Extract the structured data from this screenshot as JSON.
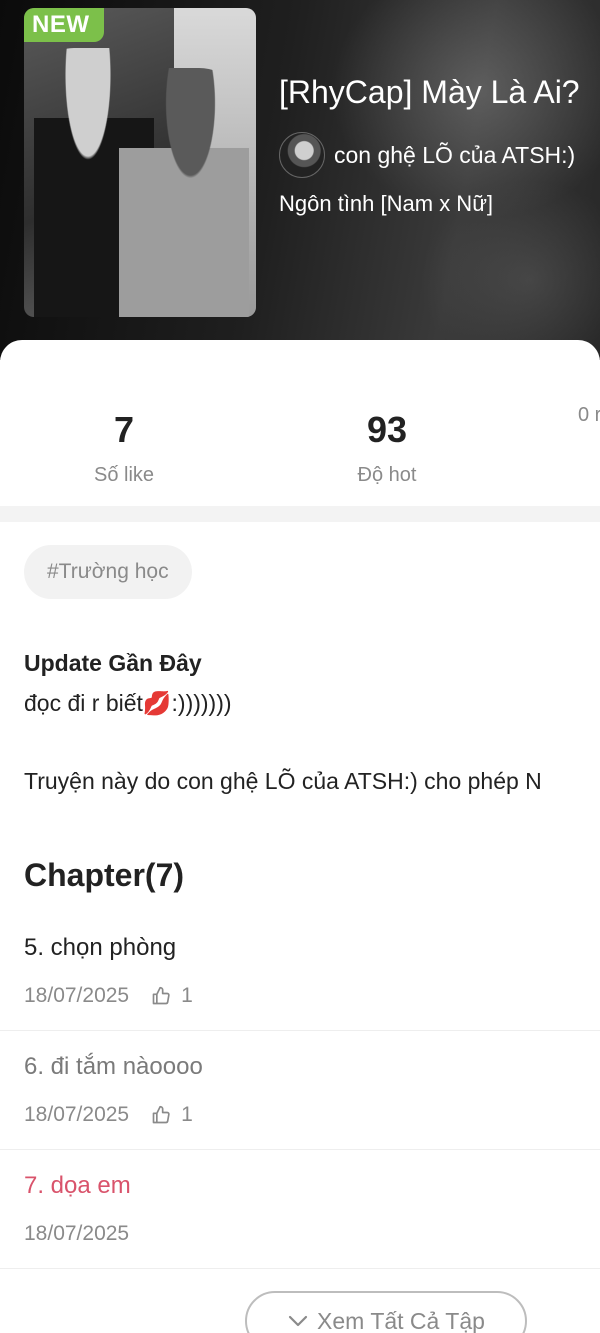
{
  "hero": {
    "badge": "NEW",
    "title": "[RhyCap] Mày Là Ai?",
    "author": "con ghệ LÕ của ATSH:)",
    "genre": "Ngôn tình [Nam x Nữ]"
  },
  "stats": [
    {
      "value": "7",
      "label": "Số like"
    },
    {
      "value": "93",
      "label": "Độ hot"
    },
    {
      "value": "",
      "label": "0 r"
    }
  ],
  "tag": "#Trường học",
  "update": {
    "title": "Update Gần Đây",
    "text": "đọc đi r biết💋:)))))))"
  },
  "permission_text": "Truyện này do con ghệ LÕ của ATSH:) cho phép N",
  "chapters": {
    "heading": "Chapter(7)",
    "items": [
      {
        "title": "5. chọn phòng",
        "date": "18/07/2025",
        "likes": "1"
      },
      {
        "title": "6. đi tắm nàoooo",
        "date": "18/07/2025",
        "likes": "1"
      },
      {
        "title": "7. dọa em",
        "date": "18/07/2025",
        "likes": ""
      }
    ],
    "view_all": "Xem Tất Cả Tập"
  },
  "colors": {
    "badge": "#7cc04a",
    "accent_chapter": "#d9536b",
    "muted": "#8a8a8a"
  },
  "icons": [
    "thumbs-up-icon",
    "chevron-down-icon"
  ]
}
